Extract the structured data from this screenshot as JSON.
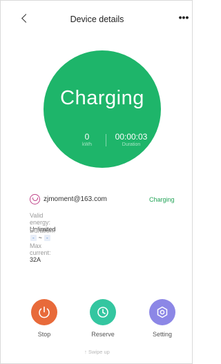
{
  "header": {
    "title": "Device details",
    "more": "•••"
  },
  "circle": {
    "status": "Charging",
    "energy_value": "0",
    "energy_label": "kWh",
    "duration_value": "00:00:03",
    "duration_label": "Duration",
    "color": "#1eb56a"
  },
  "info": {
    "email": "zjmoment@163.com",
    "status": "Charging",
    "valid_energy_label": "Valid energy: ",
    "valid_energy_value": "Unlimited",
    "duration_label": "Duration: ",
    "duration_start": "-",
    "duration_sep": "~",
    "duration_end": "-",
    "max_current_label": "Max current: ",
    "max_current_value": "32A"
  },
  "actions": {
    "stop": {
      "label": "Stop",
      "color": "#e86a3a",
      "icon": "power-icon"
    },
    "reserve": {
      "label": "Reserve",
      "color": "#34c6a0",
      "icon": "clock-icon"
    },
    "setting": {
      "label": "Setting",
      "color": "#8c87e6",
      "icon": "gear-icon"
    }
  },
  "footer": {
    "swipe_hint": "↑ Swipe up"
  }
}
